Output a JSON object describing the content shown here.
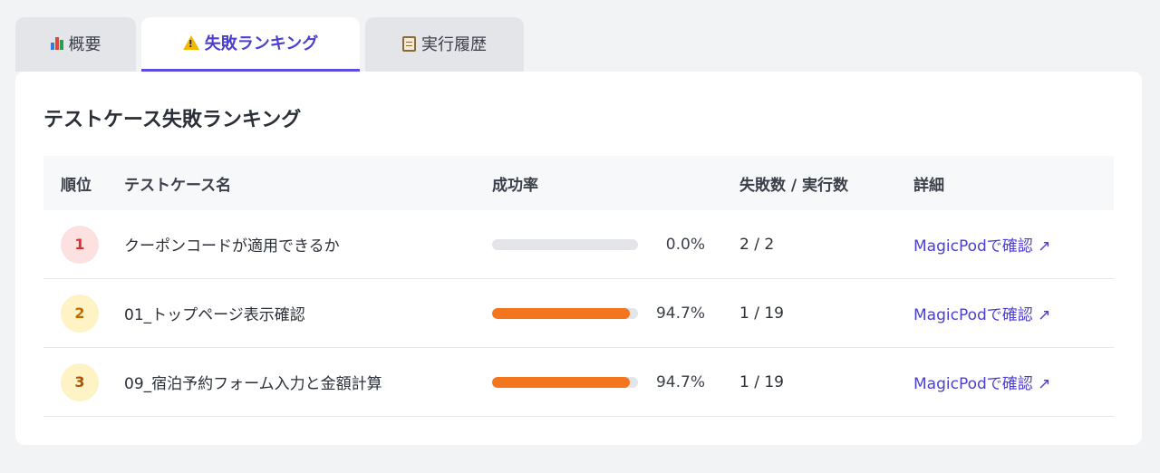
{
  "tabs": [
    {
      "label": "概要",
      "icon": "bar-chart-icon"
    },
    {
      "label": "失敗ランキング",
      "icon": "warning-icon",
      "active": true
    },
    {
      "label": "実行履歴",
      "icon": "clipboard-icon"
    }
  ],
  "card": {
    "title": "テストケース失敗ランキング"
  },
  "table": {
    "headers": {
      "rank": "順位",
      "name": "テストケース名",
      "rate": "成功率",
      "count": "失敗数 / 実行数",
      "detail": "詳細"
    },
    "rows": [
      {
        "rank": "1",
        "name": "クーポンコードが適用できるか",
        "rate": "0.0%",
        "rate_fraction": 0.0,
        "count": "2 / 2",
        "link": "MagicPodで確認 ↗"
      },
      {
        "rank": "2",
        "name": "01_トップページ表示確認",
        "rate": "94.7%",
        "rate_fraction": 0.947,
        "count": "1 / 19",
        "link": "MagicPodで確認 ↗"
      },
      {
        "rank": "3",
        "name": "09_宿泊予約フォーム入力と金額計算",
        "rate": "94.7%",
        "rate_fraction": 0.947,
        "count": "1 / 19",
        "link": "MagicPodで確認 ↗"
      }
    ]
  },
  "colors": {
    "accent": "#5b4de0",
    "bar_fill": "#f3761e",
    "rank1_bg": "#fde1e1",
    "rank_other_bg": "#fdf3c4"
  }
}
